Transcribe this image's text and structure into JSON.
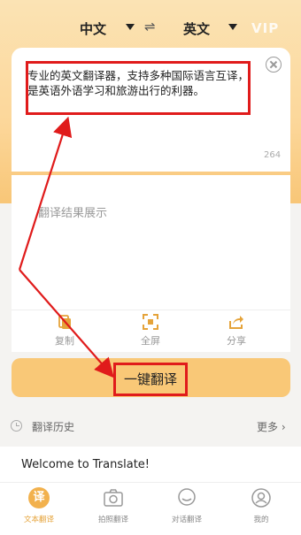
{
  "lang_bar": {
    "source": "中文",
    "target": "英文",
    "swap_symbol": "⇌",
    "vip": "VIP"
  },
  "input": {
    "text": "专业的英文翻译器，支持多种国际语言互译，是英语外语学习和旅游出行的利器。",
    "char_count": "264"
  },
  "result": {
    "placeholder": "翻译结果展示"
  },
  "tools": {
    "copy": "复制",
    "fullscreen": "全屏",
    "share": "分享"
  },
  "translate_button": "一键翻译",
  "history": {
    "title": "翻译历史",
    "more": "更多"
  },
  "welcome": "Welcome to Translate!",
  "tabs": {
    "text_badge": "译",
    "text": "文本翻译",
    "photo": "拍照翻译",
    "dialog": "对话翻译",
    "mine": "我的"
  },
  "colors": {
    "accent": "#f9c877",
    "highlight": "#e01b1b",
    "tab_active": "#e5a33a"
  },
  "icons": {
    "clear": "close-circle-icon",
    "copy": "copy-icon",
    "fullscreen": "fullscreen-icon",
    "share": "share-icon",
    "history": "clock-icon",
    "photo": "camera-icon",
    "dialog": "chat-icon",
    "mine": "user-icon"
  }
}
